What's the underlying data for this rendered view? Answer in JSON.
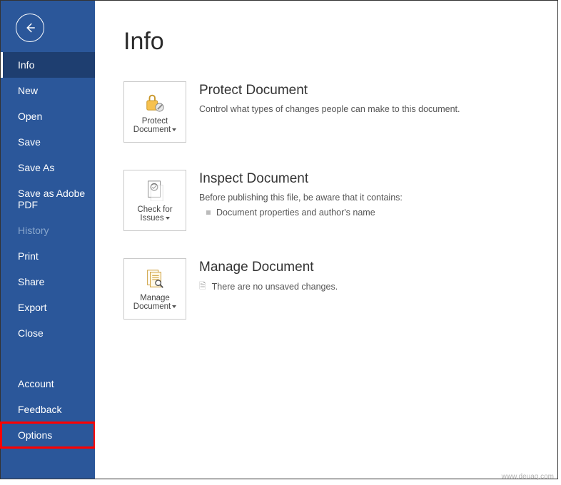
{
  "sidebar": {
    "items": [
      {
        "label": "Info",
        "active": true
      },
      {
        "label": "New"
      },
      {
        "label": "Open"
      },
      {
        "label": "Save"
      },
      {
        "label": "Save As"
      },
      {
        "label": "Save as Adobe PDF"
      },
      {
        "label": "History",
        "dim": true
      },
      {
        "label": "Print"
      },
      {
        "label": "Share"
      },
      {
        "label": "Export"
      },
      {
        "label": "Close"
      }
    ],
    "bottom": [
      {
        "label": "Account"
      },
      {
        "label": "Feedback"
      },
      {
        "label": "Options",
        "highlight": true
      }
    ]
  },
  "main": {
    "title": "Info",
    "sections": {
      "protect": {
        "tileLine1": "Protect",
        "tileLine2": "Document",
        "title": "Protect Document",
        "desc": "Control what types of changes people can make to this document."
      },
      "inspect": {
        "tileLine1": "Check for",
        "tileLine2": "Issues",
        "title": "Inspect Document",
        "desc": "Before publishing this file, be aware that it contains:",
        "bullet": "Document properties and author's name"
      },
      "manage": {
        "tileLine1": "Manage",
        "tileLine2": "Document",
        "title": "Manage Document",
        "desc": "There are no unsaved changes."
      }
    }
  },
  "watermark": "www.deuaq.com"
}
